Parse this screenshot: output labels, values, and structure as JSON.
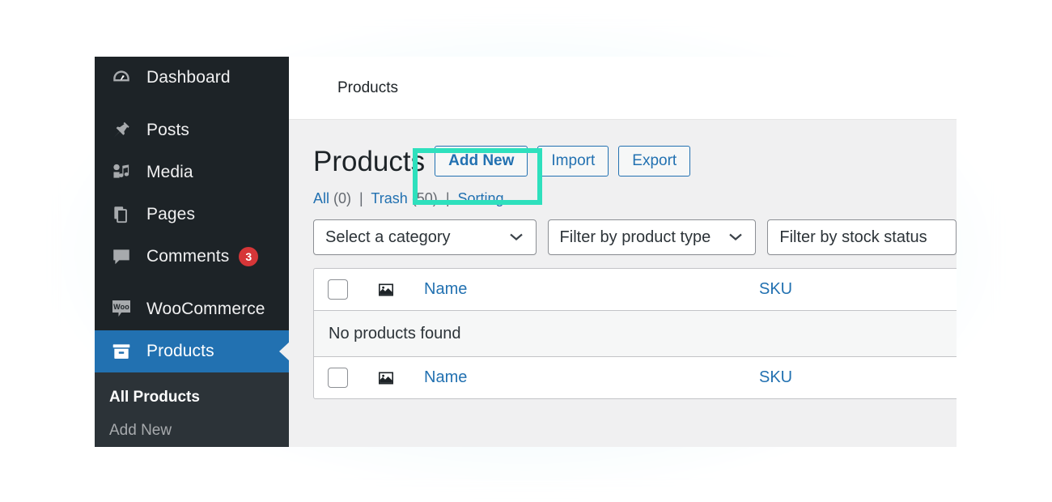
{
  "topbar": {
    "title": "Products"
  },
  "sidebar": {
    "items": [
      {
        "label": "Dashboard",
        "icon": "dashboard-icon",
        "current": false
      },
      {
        "label": "Posts",
        "icon": "pin-icon",
        "current": false
      },
      {
        "label": "Media",
        "icon": "media-icon",
        "current": false
      },
      {
        "label": "Pages",
        "icon": "pages-icon",
        "current": false
      },
      {
        "label": "Comments",
        "icon": "comment-icon",
        "current": false,
        "badge": "3"
      },
      {
        "label": "WooCommerce",
        "icon": "woo-icon",
        "current": false
      },
      {
        "label": "Products",
        "icon": "products-icon",
        "current": true
      }
    ],
    "submenu": [
      {
        "label": "All Products",
        "current": true
      },
      {
        "label": "Add New",
        "current": false
      }
    ]
  },
  "main": {
    "heading": "Products",
    "actions": [
      {
        "label": "Add New",
        "primary": true
      },
      {
        "label": "Import",
        "primary": false
      },
      {
        "label": "Export",
        "primary": false
      }
    ],
    "views": {
      "all_label": "All",
      "all_count": "(0)",
      "trash_label": "Trash",
      "trash_count": "(50)",
      "sorting_label": "Sorting",
      "separator": "|"
    },
    "filters": [
      {
        "label": "Select a category",
        "icon": "chevron-down-icon"
      },
      {
        "label": "Filter by product type",
        "icon": "chevron-down-icon"
      },
      {
        "label": "Filter by stock status",
        "icon": "chevron-down-icon"
      }
    ],
    "table": {
      "columns": {
        "image": "image-icon",
        "name": "Name",
        "sku": "SKU"
      },
      "empty_message": "No products found"
    }
  },
  "colors": {
    "accent_blue": "#2271b1",
    "sidebar_bg": "#1d2327",
    "submenu_bg": "#2c3338",
    "badge_red": "#d63638",
    "highlight_teal": "#2ee0bd"
  }
}
